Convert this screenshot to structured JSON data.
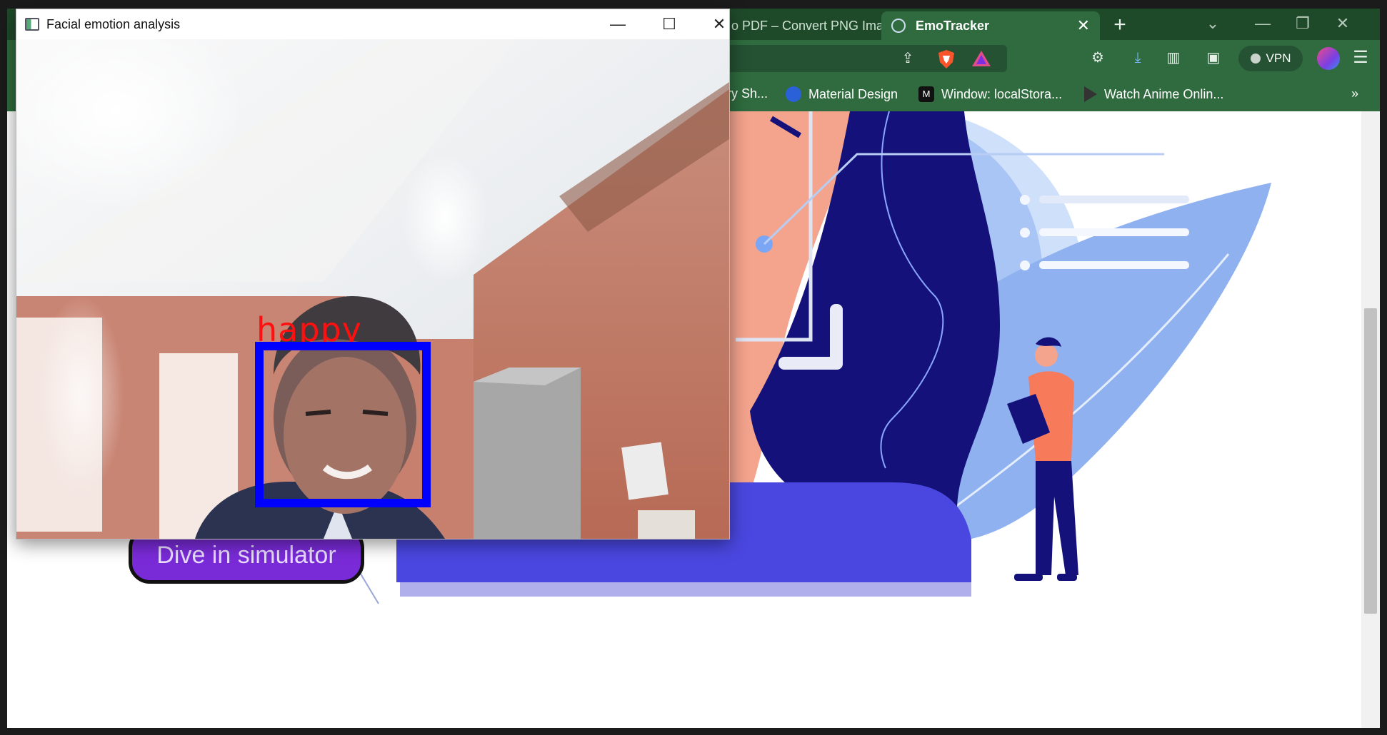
{
  "browser": {
    "tabs": [
      {
        "label": "o PDF – Convert PNG Ima",
        "active": false
      },
      {
        "label": "EmoTracker",
        "active": true
      }
    ],
    "new_tab_label": "+",
    "vpn_label": "VPN",
    "bookmarks": [
      {
        "label": "ry Sh..."
      },
      {
        "label": "Material Design"
      },
      {
        "label": "Window: localStora..."
      },
      {
        "label": "Watch Anime Onlin..."
      }
    ],
    "bookmarks_more": "»"
  },
  "page": {
    "cta_button": "Dive in simulator"
  },
  "cv_window": {
    "title": "Facial emotion analysis",
    "emotion_label": "happy",
    "box_color": "#0000ff",
    "label_color": "#ff1010"
  },
  "colors": {
    "chrome": "#2f6b3e",
    "tabstrip": "#1f4a2a",
    "accent_purple": "#7a2bd8",
    "illustration_navy": "#14127a",
    "illustration_blue": "#4a47e0"
  }
}
